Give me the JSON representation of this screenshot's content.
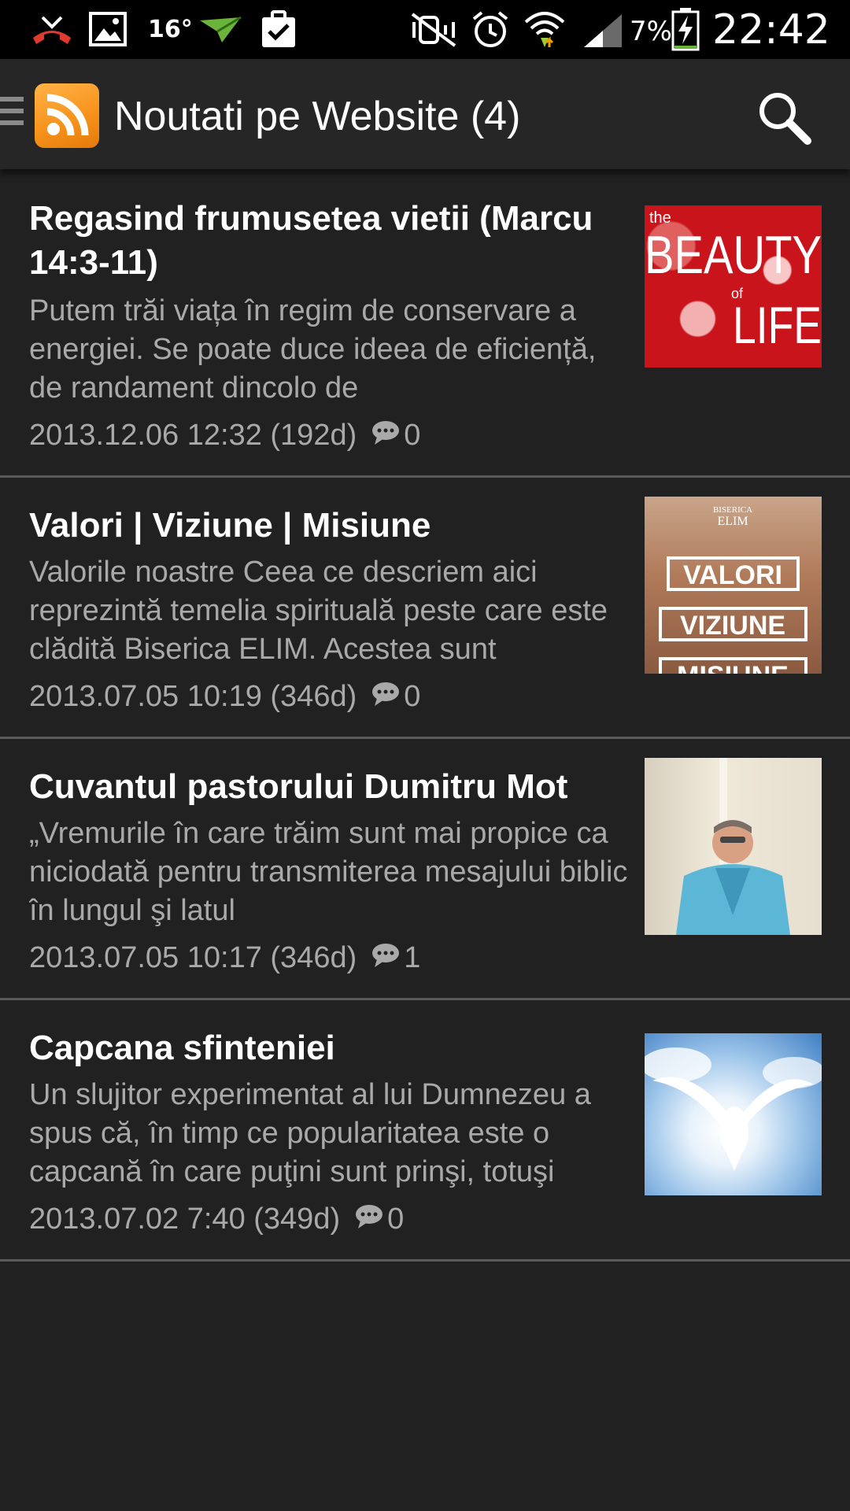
{
  "status_bar": {
    "temperature": "16°",
    "battery_percent": "7%",
    "time": "22:42",
    "icons": [
      "missed-call-icon",
      "image-icon",
      "weather-icon",
      "send-icon",
      "clipboard-check-icon",
      "mute-icon",
      "alarm-icon",
      "wifi-icon",
      "signal-icon",
      "battery-charging-icon"
    ]
  },
  "action_bar": {
    "title": "Noutati pe Website (4)",
    "icons": [
      "menu-icon",
      "rss-icon",
      "search-icon"
    ]
  },
  "articles": [
    {
      "title": "Regasind frumusetea vietii (Marcu 14:3-11)",
      "excerpt": "Putem trăi viața în regim de conservare a energiei. Se poate duce ideea de eficiență, de randament dincolo de",
      "date": "2013.12.06 12:32 (192d)",
      "comments": "0",
      "thumb_lines": [
        "the",
        "BEAUTY",
        "of",
        "LIFE"
      ]
    },
    {
      "title": "Valori | Viziune | Misiune",
      "excerpt": "Valorile noastre Ceea ce descriem aici reprezintă temelia spirituală peste care este clădită Biserica ELIM. Acestea sunt",
      "date": "2013.07.05 10:19 (346d)",
      "comments": "0",
      "thumb_lines": [
        "BISERICA",
        "ELIM",
        "VALORI",
        "VIZIUNE",
        "MISIUNE"
      ]
    },
    {
      "title": "Cuvantul pastorului Dumitru Mot",
      "excerpt": "„Vremurile în care trăim sunt mai propice ca niciodată pentru transmiterea mesajului biblic în lungul şi latul",
      "date": "2013.07.05 10:17 (346d)",
      "comments": "1"
    },
    {
      "title": "Capcana sfinteniei",
      "excerpt": "Un slujitor experimentat al lui Dumnezeu a spus că, în timp ce popularitatea este o capcană în care puţini sunt prinşi, totuşi",
      "date": "2013.07.02 7:40 (349d)",
      "comments": "0"
    }
  ],
  "colors": {
    "background": "#212121",
    "action_bar": "#262626",
    "status_bar": "#000000",
    "divider": "#5a5a5a",
    "secondary_text": "#a9a9a9",
    "rss_orange": "#f7941d"
  }
}
